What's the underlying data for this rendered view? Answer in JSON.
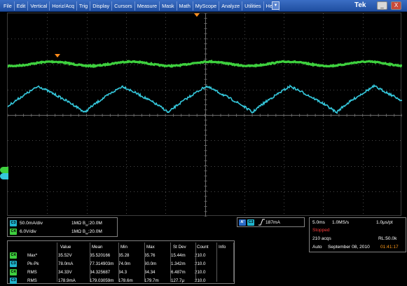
{
  "menu": {
    "items": [
      "File",
      "Edit",
      "Vertical",
      "Horiz/Acq",
      "Trig",
      "Display",
      "Cursors",
      "Measure",
      "Mask",
      "Math",
      "MyScope",
      "Analyze",
      "Utilities",
      "Help"
    ],
    "dropdown_icon": "triangle-down-icon",
    "brand": "Tek",
    "minimize_label": "_",
    "close_label": "X"
  },
  "display": {
    "traces": [
      {
        "channel": "C4",
        "color": "#3ed03e",
        "waveform": "slow ripple"
      },
      {
        "channel": "C3",
        "color": "#35c8dc",
        "waveform": "periodic noisy triangle-like wave"
      }
    ],
    "markers": [
      {
        "label": "C4",
        "color": "#3ed03e",
        "meaning": "channel 4 ground marker"
      },
      {
        "label": "C3",
        "color": "#35c8dc",
        "meaning": "channel 3 ground marker"
      }
    ],
    "trigger_marker_color": "#ff8c1a"
  },
  "channels": [
    {
      "badge": "C3",
      "badge_color": "cyan",
      "scale": "50.0mA/div",
      "impedance": "1MΩ",
      "bw_label": "B",
      "bw_sub": "W",
      "bw_value": ":20.0M"
    },
    {
      "badge": "C4",
      "badge_color": "green",
      "scale": "6.0V/div",
      "impedance": "1MΩ",
      "bw_label": "B",
      "bw_sub": "W",
      "bw_value": ":20.0M"
    }
  ],
  "trigger": {
    "source_badge": "A'",
    "channel_badge": "C3",
    "slope": "rising",
    "level": "187mA"
  },
  "acquisition": {
    "horizontal_scale": "5.0ms",
    "sample_rate": "1.0MS/s",
    "resolution": "1.0μs/pt",
    "state": "Stopped",
    "acqs": "210 acqs",
    "record_length": "RL:50.0k",
    "mode": "Auto",
    "date": "September 08, 2010",
    "time": "01:41:17",
    "state_color": "#ff3b3b",
    "time_color": "#ff9a1a"
  },
  "measurements": {
    "columns": [
      "Value",
      "Mean",
      "Min",
      "Max",
      "St Dev",
      "Count",
      "Info"
    ],
    "rows": [
      {
        "badge": "C4",
        "badge_color": "green",
        "name": "Max*",
        "values": [
          "35.52V",
          "35.520166",
          "35.28",
          "35.76",
          "15.44m",
          "210.0",
          ""
        ]
      },
      {
        "badge": "C3",
        "badge_color": "cyan",
        "name": "Pk-Pk",
        "values": [
          "78.0mA",
          "77.314903m",
          "74.0m",
          "80.0m",
          "1.342m",
          "210.0",
          ""
        ]
      },
      {
        "badge": "C4",
        "badge_color": "green",
        "name": "RMS",
        "values": [
          "34.33V",
          "34.325687",
          "34.3",
          "34.34",
          "6.487m",
          "210.0",
          ""
        ]
      },
      {
        "badge": "C3",
        "badge_color": "cyan",
        "name": "RMS",
        "values": [
          "178.9mA",
          "179.03059m",
          "178.6m",
          "179.7m",
          "127.7μ",
          "210.0",
          ""
        ]
      }
    ]
  }
}
